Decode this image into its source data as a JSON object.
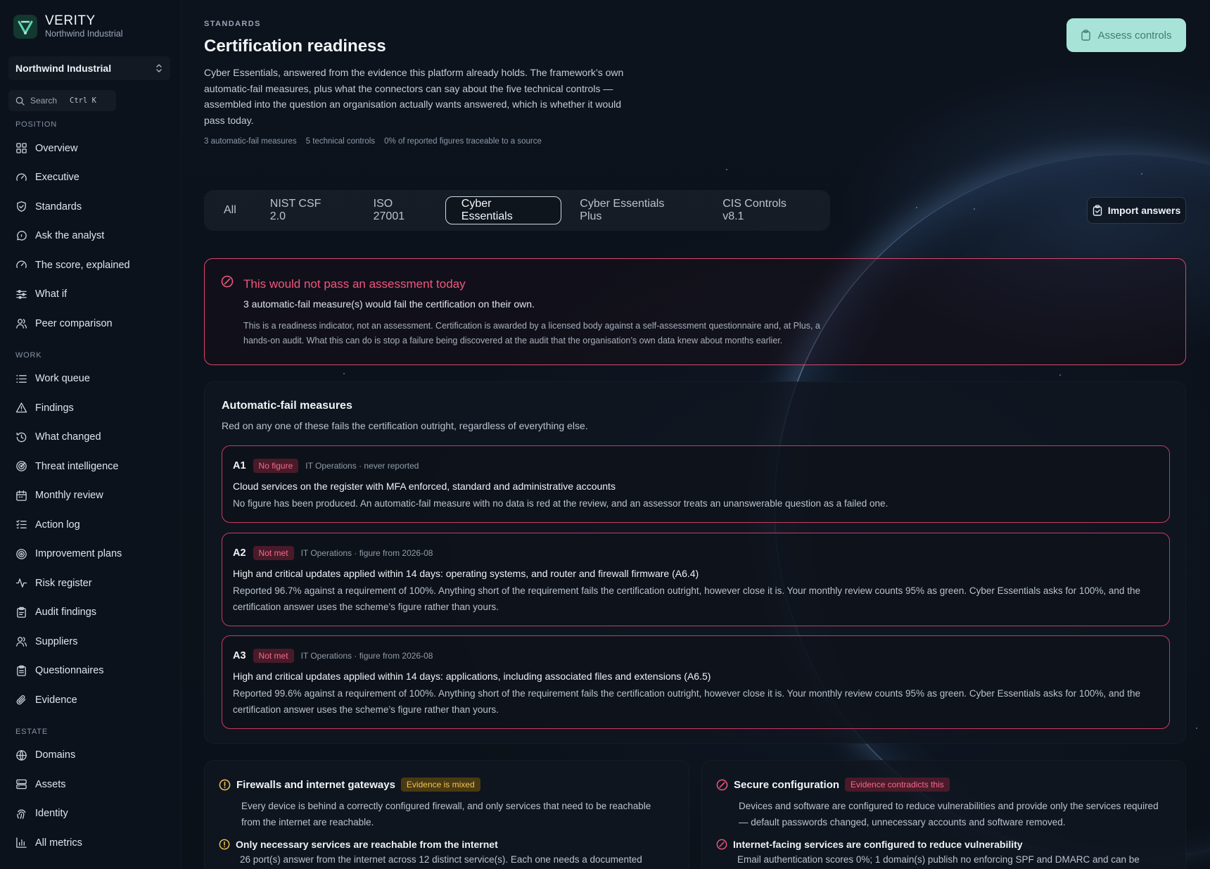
{
  "brand": {
    "name": "VERITY",
    "org": "Northwind Industrial"
  },
  "org_select": {
    "value": "Northwind Industrial"
  },
  "search": {
    "placeholder": "Search",
    "shortcut": "Ctrl K"
  },
  "nav": {
    "sections": [
      {
        "label": "POSITION",
        "items": [
          {
            "label": "Overview",
            "icon": "grid-icon"
          },
          {
            "label": "Executive",
            "icon": "gauge-icon"
          },
          {
            "label": "Standards",
            "icon": "shield-check-icon"
          },
          {
            "label": "Ask the analyst",
            "icon": "chat-icon"
          },
          {
            "label": "The score, explained",
            "icon": "gauge-icon"
          },
          {
            "label": "What if",
            "icon": "sliders-icon"
          },
          {
            "label": "Peer comparison",
            "icon": "users-icon"
          }
        ]
      },
      {
        "label": "WORK",
        "items": [
          {
            "label": "Work queue",
            "icon": "list-icon"
          },
          {
            "label": "Findings",
            "icon": "warning-icon"
          },
          {
            "label": "What changed",
            "icon": "history-icon"
          },
          {
            "label": "Threat intelligence",
            "icon": "radar-icon"
          },
          {
            "label": "Monthly review",
            "icon": "calendar-icon"
          },
          {
            "label": "Action log",
            "icon": "checklist-icon"
          },
          {
            "label": "Improvement plans",
            "icon": "target-icon"
          },
          {
            "label": "Risk register",
            "icon": "activity-icon"
          },
          {
            "label": "Audit findings",
            "icon": "clipboard-icon"
          },
          {
            "label": "Suppliers",
            "icon": "users-icon"
          },
          {
            "label": "Questionnaires",
            "icon": "clipboard-list-icon"
          },
          {
            "label": "Evidence",
            "icon": "paperclip-icon"
          }
        ]
      },
      {
        "label": "ESTATE",
        "items": [
          {
            "label": "Domains",
            "icon": "globe-icon"
          },
          {
            "label": "Assets",
            "icon": "server-icon"
          },
          {
            "label": "Identity",
            "icon": "fingerprint-icon"
          },
          {
            "label": "All metrics",
            "icon": "bar-chart-icon"
          }
        ]
      }
    ]
  },
  "page": {
    "eyebrow": "STANDARDS",
    "title": "Certification readiness",
    "intro": "Cyber Essentials, answered from the evidence this platform already holds. The framework’s own automatic-fail measures, plus what the connectors can say about the five technical controls — assembled into the question an organisation actually wants answered, which is whether it would pass today.",
    "meta": [
      "3 automatic-fail measures",
      "5 technical controls",
      "0% of reported figures traceable to a source"
    ],
    "assess_button": "Assess controls",
    "import_button": "Import answers"
  },
  "tabs": [
    {
      "label": "All",
      "active": false
    },
    {
      "label": "NIST CSF 2.0",
      "active": false
    },
    {
      "label": "ISO 27001",
      "active": false
    },
    {
      "label": "Cyber Essentials",
      "active": true
    },
    {
      "label": "Cyber Essentials Plus",
      "active": false
    },
    {
      "label": "CIS Controls v8.1",
      "active": false
    }
  ],
  "alert": {
    "title": "This would not pass an assessment today",
    "subtitle": "3 automatic-fail measure(s) would fail the certification on their own.",
    "note": "This is a readiness indicator, not an assessment. Certification is awarded by a licensed body against a self-assessment questionnaire and, at Plus, a hands-on audit. What this can do is stop a failure being discovered at the audit that the organisation’s own data knew about months earlier."
  },
  "auto_fail": {
    "title": "Automatic-fail measures",
    "subtitle": "Red on any one of these fails the certification outright, regardless of everything else.",
    "measures": [
      {
        "code": "A1",
        "badge": "No figure",
        "owner": "IT Operations · never reported",
        "title": "Cloud services on the register with MFA enforced, standard and administrative accounts",
        "body": "No figure has been produced. An automatic-fail measure with no data is red at the review, and an assessor treats an unanswerable question as a failed one."
      },
      {
        "code": "A2",
        "badge": "Not met",
        "owner": "IT Operations · figure from 2026-08",
        "title": "High and critical updates applied within 14 days: operating systems, and router and firewall firmware (A6.4)",
        "body": "Reported 96.7% against a requirement of 100%. Anything short of the requirement fails the certification outright, however close it is. Your monthly review counts 95% as green. Cyber Essentials asks for 100%, and the certification answer uses the scheme’s figure rather than yours."
      },
      {
        "code": "A3",
        "badge": "Not met",
        "owner": "IT Operations · figure from 2026-08",
        "title": "High and critical updates applied within 14 days: applications, including associated files and extensions (A6.5)",
        "body": "Reported 99.6% against a requirement of 100%. Anything short of the requirement fails the certification outright, however close it is. Your monthly review counts 95% as green. Cyber Essentials asks for 100%, and the certification answer uses the scheme’s figure rather than yours."
      }
    ]
  },
  "controls": [
    {
      "title": "Firewalls and internet gateways",
      "badge": "Evidence is mixed",
      "status": "warn",
      "desc_lines": [
        "Every device is behind a correctly configured firewall, and only services that need to be reachable",
        "from the internet are reachable."
      ],
      "sub_title": "Only necessary services are reachable from the internet",
      "sub_desc": "26 port(s) answer from the internet across 12 distinct service(s). Each one needs a documented"
    },
    {
      "title": "Secure configuration",
      "badge": "Evidence contradicts this",
      "status": "bad",
      "desc_lines": [
        "Devices and software are configured to reduce vulnerabilities and provide only the services required",
        "— default passwords changed, unnecessary accounts and software removed."
      ],
      "sub_title": "Internet-facing services are configured to reduce vulnerability",
      "sub_desc": "Email authentication scores 0%; 1 domain(s) publish no enforcing SPF and DMARC and can be"
    }
  ],
  "colors": {
    "accent": "#a7e3d6",
    "danger": "#f0567e",
    "warning": "#f0c555",
    "background": "#0b1119"
  }
}
